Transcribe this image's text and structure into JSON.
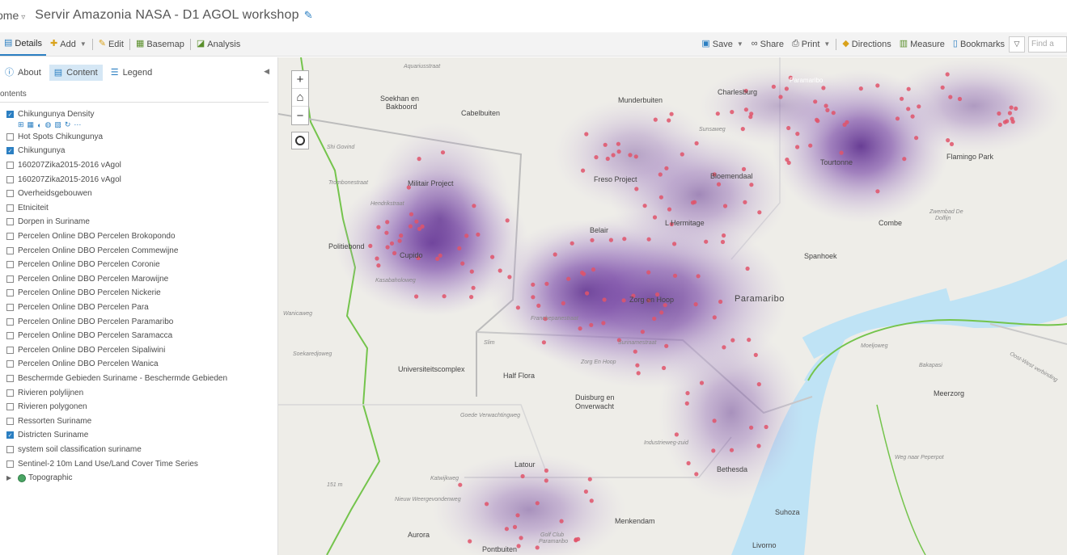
{
  "title_bar": {
    "home_label": "ome",
    "title": "Servir Amazonia NASA - D1 AGOL workshop"
  },
  "toolbar": {
    "details": "Details",
    "add": "Add",
    "edit": "Edit",
    "basemap": "Basemap",
    "analysis": "Analysis",
    "save": "Save",
    "share": "Share",
    "print": "Print",
    "directions": "Directions",
    "measure": "Measure",
    "bookmarks": "Bookmarks",
    "find_placeholder": "Find a"
  },
  "sidebar": {
    "tabs": [
      {
        "label": "About"
      },
      {
        "label": "Content"
      },
      {
        "label": "Legend"
      }
    ],
    "contents_label": "ontents",
    "layers": [
      {
        "label": "Chikungunya Density",
        "checked": true
      },
      {
        "label": "Hot Spots Chikungunya",
        "checked": false
      },
      {
        "label": "Chikungunya",
        "checked": true
      },
      {
        "label": "160207Zika2015-2016 vAgol",
        "checked": false
      },
      {
        "label": "160207Zika2015-2016 vAgol",
        "checked": false
      },
      {
        "label": "Overheidsgebouwen",
        "checked": false
      },
      {
        "label": "Etniciteit",
        "checked": false
      },
      {
        "label": "Dorpen in Suriname",
        "checked": false
      },
      {
        "label": "Percelen Online DBO Percelen Brokopondo",
        "checked": false
      },
      {
        "label": "Percelen Online DBO Percelen Commewijne",
        "checked": false
      },
      {
        "label": "Percelen Online DBO Percelen Coronie",
        "checked": false
      },
      {
        "label": "Percelen Online DBO Percelen Marowijne",
        "checked": false
      },
      {
        "label": "Percelen Online DBO Percelen Nickerie",
        "checked": false
      },
      {
        "label": "Percelen Online DBO Percelen Para",
        "checked": false
      },
      {
        "label": "Percelen Online DBO Percelen Paramaribo",
        "checked": false
      },
      {
        "label": "Percelen Online DBO Percelen Saramacca",
        "checked": false
      },
      {
        "label": "Percelen Online DBO Percelen Sipaliwini",
        "checked": false
      },
      {
        "label": "Percelen Online DBO Percelen Wanica",
        "checked": false
      },
      {
        "label": "Beschermde Gebieden Suriname - Beschermde Gebieden",
        "checked": false
      },
      {
        "label": "Rivieren polylijnen",
        "checked": false
      },
      {
        "label": "Rivieren polygonen",
        "checked": false
      },
      {
        "label": "Ressorten Suriname",
        "checked": false
      },
      {
        "label": "Districten Suriname",
        "checked": true
      },
      {
        "label": "system soil classification suriname",
        "checked": false
      },
      {
        "label": "Sentinel-2 10m Land Use/Land Cover Time Series",
        "checked": false
      }
    ],
    "basemap_label": "Topographic"
  },
  "map": {
    "labels": {
      "sekhan": "Soekhan en",
      "bakboord": "Bakboord",
      "cabelbuiten": "Cabelbuiten",
      "munderbuiten": "Munderbuiten",
      "charlesburg": "Charlesburg",
      "paramaribo_top": "Paramaribo",
      "militair": "Militair Project",
      "freso": "Freso Project",
      "bloemendaal": "Bloemendaal",
      "tourtonne": "Tourtonne",
      "flamingo": "Flamingo Park",
      "combe": "Combe",
      "zwembad": "Zwembad De",
      "dolfijn": "Dolfijn",
      "hermitage": "L Hermitage",
      "belair": "Belair",
      "politiebond": "Politiebond",
      "cupido": "Cupido",
      "spanhoek": "Spanhoek",
      "paramaribo": "Paramaribo",
      "zorg": "Zorg en Hoop",
      "wanicaweg": "Wanicaweg",
      "universiteitscomplex": "Universiteitscomplex",
      "half_flora": "Half Flora",
      "duisburg": "Duisburg en",
      "onverwacht": "Onverwacht",
      "meerzorg": "Meerzorg",
      "latour": "Latour",
      "bethesda": "Bethesda",
      "suhoza": "Suhoza",
      "menkendam": "Menkendam",
      "aurora": "Aurora",
      "pontbuiten": "Pontbuiten",
      "livorno": "Livorno",
      "golfclub": "Golf Club",
      "golfclub2": "Paramaribo",
      "oost_west": "Oost-West verbinding",
      "moeljoweg": "Moeljoweg",
      "bakapasi": "Bakapasi",
      "weg_naar": "Weg naar Peperpot",
      "katwijkweg": "Katwijkweg",
      "elevation": "151 m",
      "shi_govind": "Shi Govind",
      "trombonestraat": "Trombonestraat",
      "hendrikstraat": "Hendrikstraat",
      "kasabaholoweg": "Kasabaholoweg",
      "soekaredjoweg": "Soekaredjoweg",
      "goede_verwachting": "Goede Verwachtingweg",
      "nieuw_weergevonden": "Nieuw Weergevondenweg",
      "industrieweg": "Industrieweg-zuid",
      "aquariusstraat": "Aquariusstraat",
      "sunsaweg": "Sunsaweg",
      "slim": "Slim",
      "zorg_hoop_small": "Zorg En Hoop",
      "surinamestraat": "Surinamestraat",
      "frenchstraat": "Franchepanestraat",
      "commissaris": "Commissaris",
      "rembrandtstraat": "Rembrandtstraat",
      "leiding_22": "Leiding 22",
      "leiding_11b": "Leiding 11B",
      "anton_dr": "Anton Dr",
      "hotspot_small": "+2"
    }
  },
  "colors": {
    "accent": "#2b7fc2",
    "density": "#5a2b8c",
    "points": "#e0546a",
    "water": "#bfe3f5",
    "boundary": "#74c44c"
  }
}
